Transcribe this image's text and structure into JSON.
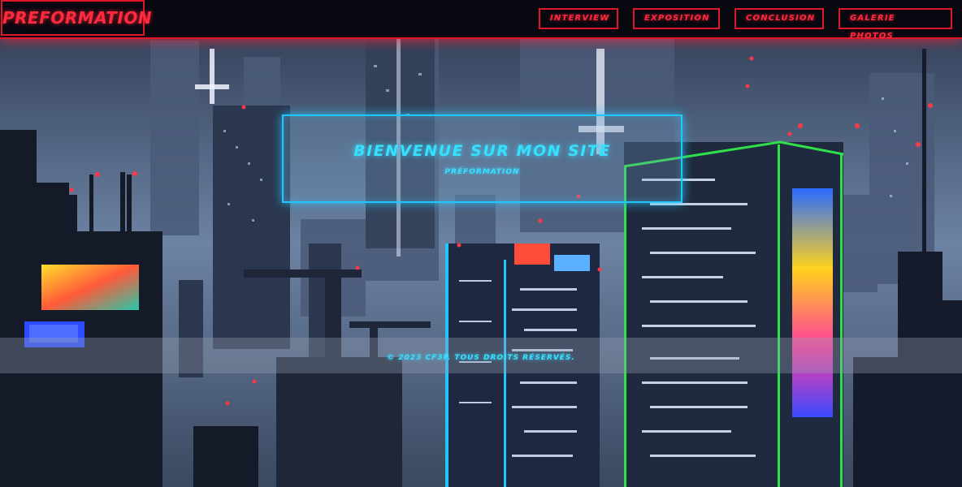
{
  "header": {
    "brand": "PREFORMATION",
    "nav": [
      {
        "label": "INTERVIEW"
      },
      {
        "label": "EXPOSITION"
      },
      {
        "label": "CONCLUSION"
      },
      {
        "label": "GALERIE PHOTOS"
      }
    ]
  },
  "hero": {
    "title": "BIENVENUE SUR MON SITE",
    "subtitle": "PRÉFORMATION"
  },
  "footer": {
    "text": "© 2023 CF3P. TOUS DROITS RÉSERVÉS."
  },
  "colors": {
    "accent_red": "#e0162b",
    "accent_cyan": "#36e0ff",
    "header_bg": "#07070f"
  }
}
